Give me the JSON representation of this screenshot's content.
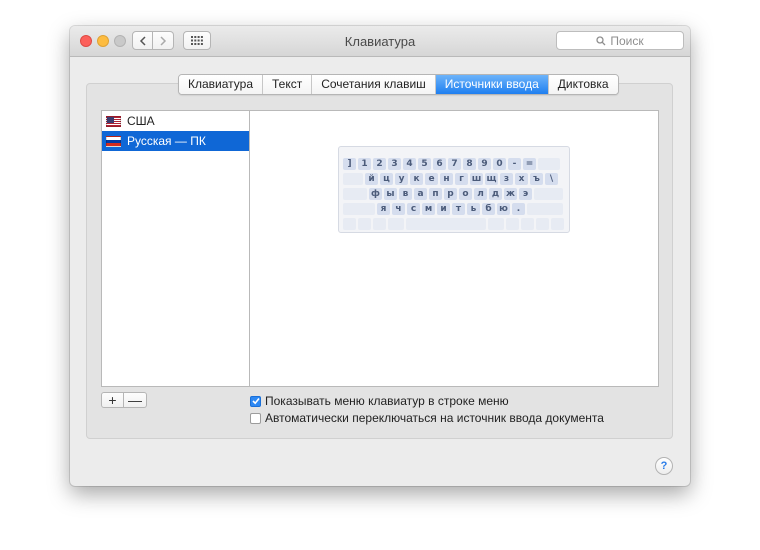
{
  "window": {
    "title": "Клавиатура",
    "search_placeholder": "Поиск"
  },
  "icons": {
    "back": "chevron-left-icon",
    "forward": "chevron-right-icon",
    "grid": "grid-icon",
    "search": "magnifier-icon",
    "help": "help-icon"
  },
  "tabs": [
    {
      "label": "Клавиатура",
      "active": false
    },
    {
      "label": "Текст",
      "active": false
    },
    {
      "label": "Сочетания клавиш",
      "active": false
    },
    {
      "label": "Источники ввода",
      "active": true
    },
    {
      "label": "Диктовка",
      "active": false
    }
  ],
  "sources": [
    {
      "label": "США",
      "flag": "us",
      "selected": false
    },
    {
      "label": "Русская — ПК",
      "flag": "ru",
      "selected": true
    }
  ],
  "keyboard_preview": {
    "row1": [
      "]",
      "1",
      "2",
      "3",
      "4",
      "5",
      "6",
      "7",
      "8",
      "9",
      "0",
      "-",
      "="
    ],
    "row2": [
      "й",
      "ц",
      "у",
      "к",
      "е",
      "н",
      "г",
      "ш",
      "щ",
      "з",
      "х",
      "ъ",
      "\\"
    ],
    "row3": [
      "ф",
      "ы",
      "в",
      "а",
      "п",
      "р",
      "о",
      "л",
      "д",
      "ж",
      "э"
    ],
    "row4": [
      "я",
      "ч",
      "с",
      "м",
      "и",
      "т",
      "ь",
      "б",
      "ю",
      "."
    ]
  },
  "buttons": {
    "add": "+",
    "remove": "—",
    "help": "?"
  },
  "options": {
    "show_menu": {
      "label": "Показывать меню клавиатур в строке меню",
      "checked": true
    },
    "auto_switch": {
      "label": "Автоматически переключаться на источник ввода документа",
      "checked": false
    }
  },
  "colors": {
    "accent": "#1f7ff0",
    "selection": "#0f67d6"
  }
}
